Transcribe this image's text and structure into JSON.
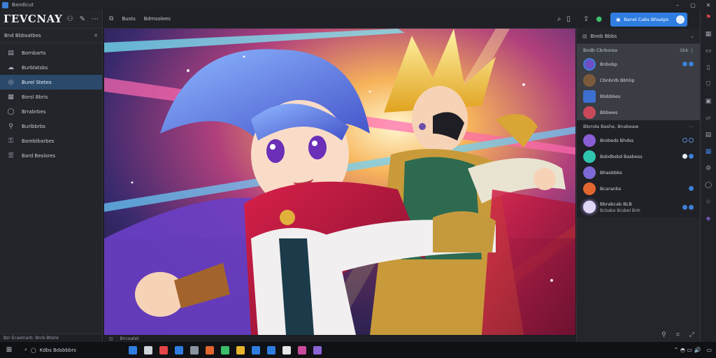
{
  "window": {
    "title": "Bandicut",
    "controls": [
      "–",
      "▢",
      "✕"
    ]
  },
  "sidebar": {
    "brand": "ГEVCNAY",
    "section_title": "Bnd Bbbsatbes",
    "items": [
      {
        "label": "Bornbarts",
        "icon": "stack-icon"
      },
      {
        "label": "Burblatsbs",
        "icon": "cloud-icon"
      },
      {
        "label": "Burel Stetes",
        "icon": "target-icon",
        "active": true
      },
      {
        "label": "Borsl Bbris",
        "icon": "grid-icon"
      },
      {
        "label": "Brrabrbes",
        "icon": "circle-icon"
      },
      {
        "label": "Burlbbrbs",
        "icon": "pin-icon"
      },
      {
        "label": "Bareblbarbes",
        "icon": "key-icon"
      },
      {
        "label": "Bard Beslores",
        "icon": "list-icon"
      }
    ],
    "footer": "Bzr Ecaelnarb: Bnrb Btslre"
  },
  "topbar": {
    "tabs": [
      "Busts",
      "Bdmsolees"
    ]
  },
  "status_main": {
    "text": "Bncaatet"
  },
  "right_panel": {
    "cta_label": "Banel Cabs Bhsalps",
    "header": "Bneb Bbbs",
    "group_a": {
      "title": "Bndb Cbrborea",
      "meta": "Sbb ❘",
      "channels": [
        {
          "name": "Bnbobp",
          "color": "#6d4fc7"
        },
        {
          "name": "Cbnbnlb Bbhlip",
          "color": "#7b5a3b"
        },
        {
          "name": "Blsbbbes",
          "color": "#3d6fd0"
        },
        {
          "name": "Bbbwes",
          "color": "#c84a5a"
        }
      ]
    },
    "group_b": {
      "title": "Bbmda Bashe, Bnabeaw",
      "meta": "",
      "channels": [
        {
          "name": "Brobeds Bhdss",
          "color": "#8a5dd6"
        },
        {
          "name": "Bsbdbsbd Basbess",
          "color": "#2fc6b0"
        },
        {
          "name": "Bhasbbbs",
          "color": "#7e6ad6"
        },
        {
          "name": "Bcaranbs",
          "color": "#e2662f"
        },
        {
          "name": "Bbrabcab BLB",
          "sub": "Bcbabo Bcsbel Bnh",
          "color": "#e0d8f4"
        }
      ]
    }
  },
  "taskbar": {
    "search_label": "Kdbs Bdsbbbrs",
    "apps": [
      "#2f7de1",
      "#cfd3da",
      "#e24646",
      "#2f7de1",
      "#8a93a0",
      "#e2662f",
      "#3cbf6a",
      "#e8b52c",
      "#2f7de1",
      "#2f7de1",
      "#e6e6e6",
      "#c84a9a",
      "#8a63d6"
    ],
    "tray": "⌃ ◓ ▭ 🔊"
  },
  "colors": {
    "accent": "#2f7de1",
    "active_nav": "#2b4a6b",
    "badge_red": "#e24646"
  }
}
